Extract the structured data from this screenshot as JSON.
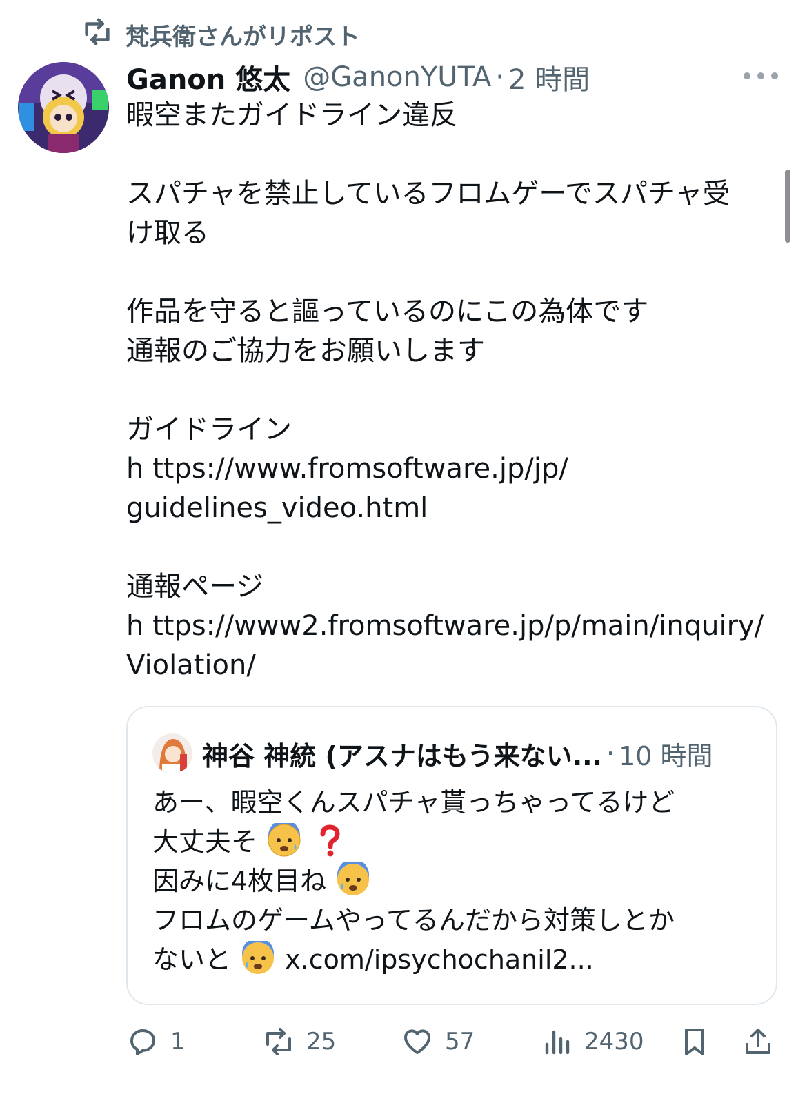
{
  "repost_header": {
    "icon": "repost-icon",
    "text": "梵兵衛さんがリポスト"
  },
  "tweet": {
    "display_name": "Ganon 悠太",
    "handle": "@GanonYUTA",
    "separator": "·",
    "time": "2 時間",
    "lines": [
      "暇空またガイドライン違反",
      "",
      "スパチャを禁止しているフロムゲーでスパチャ受",
      "け取る",
      "",
      "作品を守ると謳っているのにこの為体です",
      "通報のご協力をお願いします",
      "",
      "ガイドライン",
      "h ttps://www.fromsoftware.jp/jp/",
      "guidelines_video.html",
      "",
      "通報ページ",
      "h ttps://www2.fromsoftware.jp/p/main/inquiry/",
      "Violation/"
    ]
  },
  "quote": {
    "name": "神谷 神統 (アスナはもう来ない...",
    "separator": "·",
    "time": "10 時間",
    "line1": "あー、暇空くんスパチャ貰っちゃってるけど",
    "line2": "大丈夫そ",
    "line3": "因みに4枚目ね",
    "line4": "フロムのゲームやってるんだから対策しとか",
    "line5_pre": "ないと",
    "line5_link": " x.com/ipsychochanil2..."
  },
  "actions": {
    "reply": {
      "icon": "reply-icon",
      "count": "1"
    },
    "repost": {
      "icon": "repost-icon",
      "count": "25"
    },
    "like": {
      "icon": "heart-icon",
      "count": "57"
    },
    "views": {
      "icon": "views-icon",
      "count": "2430"
    },
    "bookmark": {
      "icon": "bookmark-icon"
    },
    "share": {
      "icon": "share-icon"
    }
  },
  "colors": {
    "text": "#0f1419",
    "secondary": "#536471",
    "border": "#e1e8ed",
    "question": "#e0242f"
  }
}
